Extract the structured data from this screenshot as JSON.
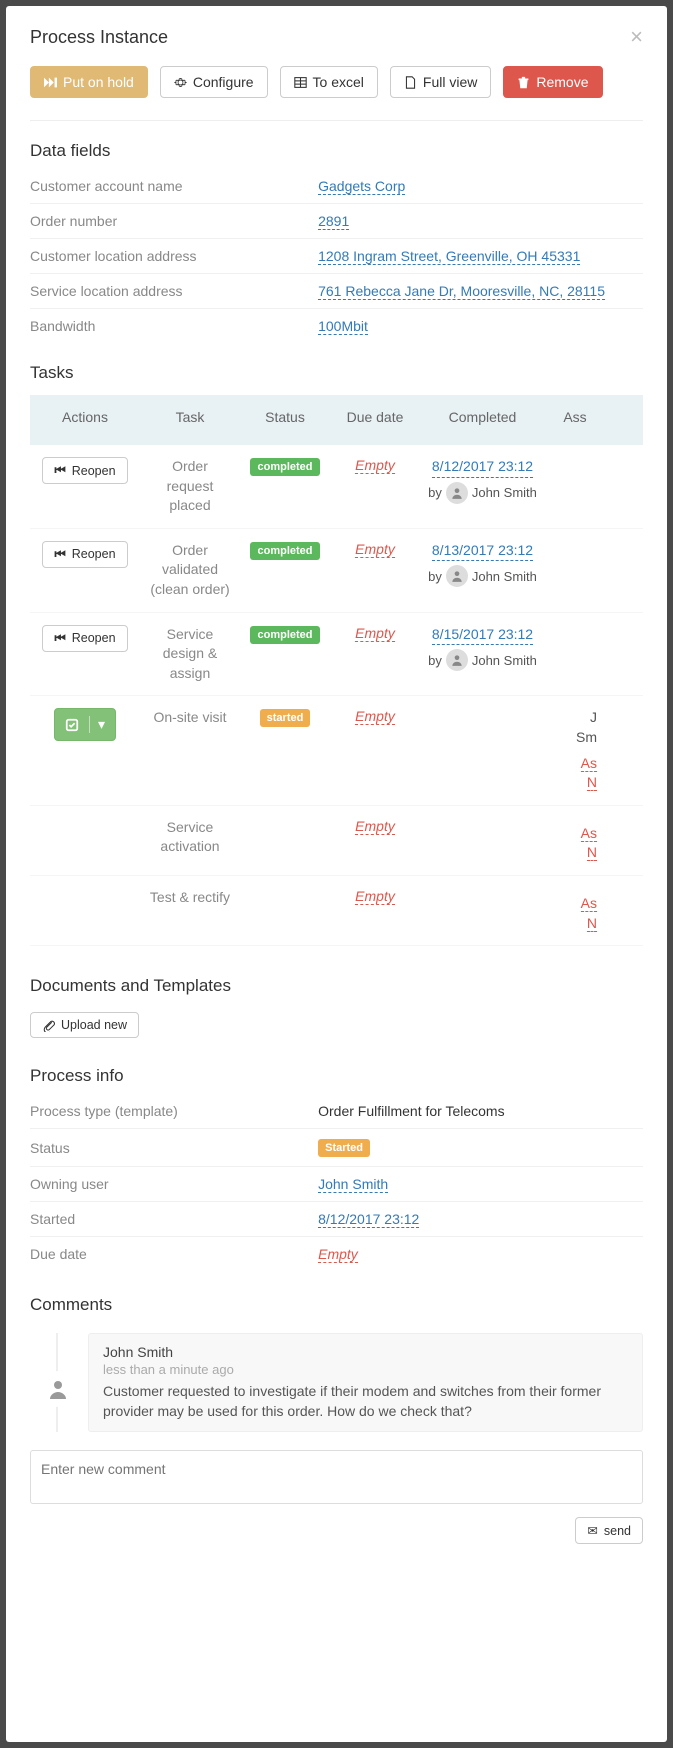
{
  "modal": {
    "title": "Process Instance"
  },
  "action_buttons": {
    "hold": "Put on hold",
    "configure": "Configure",
    "excel": "To excel",
    "fullview": "Full view",
    "remove": "Remove"
  },
  "sections": {
    "data_fields": "Data fields",
    "tasks": "Tasks",
    "documents": "Documents and Templates",
    "process_info": "Process info",
    "comments": "Comments"
  },
  "data_fields": [
    {
      "label": "Customer account name",
      "value": "Gadgets Corp",
      "type": "link"
    },
    {
      "label": "Order number",
      "value": "2891",
      "type": "link"
    },
    {
      "label": "Customer location address",
      "value": "1208 Ingram Street, Greenville, OH 45331",
      "type": "link"
    },
    {
      "label": "Service location address",
      "value": "761 Rebecca Jane Dr, Mooresville, NC, 28115",
      "type": "link"
    },
    {
      "label": "Bandwidth",
      "value": "100Mbit",
      "type": "link"
    }
  ],
  "task_headers": {
    "actions": "Actions",
    "task": "Task",
    "status": "Status",
    "due": "Due date",
    "completed": "Completed",
    "assignee": "Ass"
  },
  "tasks": [
    {
      "action": "Reopen",
      "action_type": "reopen",
      "name": "Order request placed",
      "status": "completed",
      "status_class": "completed",
      "due": "Empty",
      "completed_date": "8/12/2017 23:12",
      "completed_by": "John Smith",
      "assignee": ""
    },
    {
      "action": "Reopen",
      "action_type": "reopen",
      "name": "Order validated (clean order)",
      "status": "completed",
      "status_class": "completed",
      "due": "Empty",
      "completed_date": "8/13/2017 23:12",
      "completed_by": "John Smith",
      "assignee": ""
    },
    {
      "action": "Reopen",
      "action_type": "reopen",
      "name": "Service design & assign",
      "status": "completed",
      "status_class": "completed",
      "due": "Empty",
      "completed_date": "8/15/2017 23:12",
      "completed_by": "John Smith",
      "assignee": ""
    },
    {
      "action": "",
      "action_type": "check",
      "name": "On-site visit",
      "status": "started",
      "status_class": "started",
      "due": "Empty",
      "completed_date": "",
      "completed_by": "",
      "assignee_lines": [
        "J",
        "Sm",
        "As",
        "N"
      ]
    },
    {
      "action": "",
      "action_type": "none",
      "name": "Service activation",
      "status": "",
      "status_class": "",
      "due": "Empty",
      "completed_date": "",
      "completed_by": "",
      "assignee_lines": [
        "As",
        "N"
      ]
    },
    {
      "action": "",
      "action_type": "none",
      "name": "Test & rectify",
      "status": "",
      "status_class": "",
      "due": "Empty",
      "completed_date": "",
      "completed_by": "",
      "assignee_lines": [
        "As",
        "N"
      ]
    }
  ],
  "upload_label": "Upload new",
  "process_info": [
    {
      "label": "Process type (template)",
      "value": "Order Fulfillment for Telecoms",
      "type": "static"
    },
    {
      "label": "Status",
      "value": "Started",
      "type": "badge"
    },
    {
      "label": "Owning user",
      "value": "John Smith",
      "type": "link"
    },
    {
      "label": "Started",
      "value": "8/12/2017 23:12",
      "type": "link"
    },
    {
      "label": "Due date",
      "value": "Empty",
      "type": "empty"
    }
  ],
  "comment": {
    "author": "John Smith",
    "time": "less than a minute ago",
    "body": "Customer requested to investigate if their modem and switches from their former provider may be used for this order. How do we check that?"
  },
  "new_comment_placeholder": "Enter new comment",
  "send_label": "send",
  "by_label": "by"
}
